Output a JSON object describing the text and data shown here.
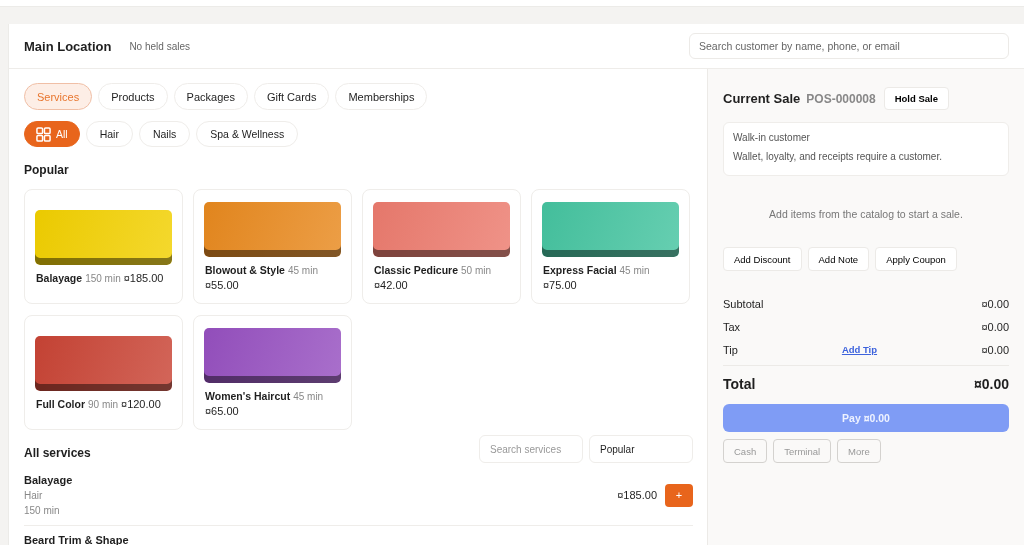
{
  "header": {
    "location": "Main Location",
    "held_sales": "No held sales",
    "customer_search": {
      "placeholder": "Search customer by name, phone, or email"
    }
  },
  "catalog": {
    "tabs": [
      {
        "label": "Services",
        "selected": true
      },
      {
        "label": "Products",
        "selected": false
      },
      {
        "label": "Packages",
        "selected": false
      },
      {
        "label": "Gift Cards",
        "selected": false
      },
      {
        "label": "Memberships",
        "selected": false
      }
    ],
    "filters": [
      {
        "label": "All",
        "selected": true,
        "kind": "grid"
      },
      {
        "label": "Hair",
        "selected": false,
        "kind": "plain"
      },
      {
        "label": "Nails",
        "selected": false,
        "kind": "plain"
      },
      {
        "label": "Spa & Wellness",
        "selected": false,
        "kind": "plain"
      }
    ],
    "popular_title": "Popular",
    "popular": [
      {
        "name": "Balayage",
        "duration": "150 min",
        "price": "¤185.00",
        "color": "#f2d000"
      },
      {
        "name": "Blowout & Style",
        "duration": "45 min",
        "price": "¤55.00",
        "color": "#e8891e"
      },
      {
        "name": "Classic Pedicure",
        "duration": "50 min",
        "price": "¤42.00",
        "color": "#ec7b6e"
      },
      {
        "name": "Express Facial",
        "duration": "45 min",
        "price": "¤75.00",
        "color": "#45c4a0"
      },
      {
        "name": "Full Color",
        "duration": "90 min",
        "price": "¤120.00",
        "color": "#c94435"
      },
      {
        "name": "Women's Haircut",
        "duration": "45 min",
        "price": "¤65.00",
        "color": "#9650c0"
      }
    ],
    "all_title": "All services",
    "service_search": {
      "placeholder": "Search services"
    },
    "sort": "Popular",
    "services": [
      {
        "name": "Balayage",
        "category": "Hair",
        "duration": "150 min",
        "price": "¤185.00",
        "add": "+"
      },
      {
        "name": "Beard Trim & Shape"
      }
    ]
  },
  "sale": {
    "title": "Current Sale",
    "number": "POS-000008",
    "hold": "Hold Sale",
    "customer": "Walk-in customer",
    "customer_note": "Wallet, loyalty, and receipts require a customer.",
    "empty": "Add items from the catalog to start a sale.",
    "actions": [
      "Add Discount",
      "Add Note",
      "Apply Coupon"
    ],
    "totals": [
      {
        "label": "Subtotal",
        "value": "¤0.00"
      },
      {
        "label": "Tax",
        "value": "¤0.00"
      },
      {
        "label": "Tip",
        "value": "¤0.00",
        "link": "Add Tip"
      }
    ],
    "total": {
      "label": "Total",
      "value": "¤0.00"
    },
    "pay": {
      "label": "Pay ¤0.00",
      "disabled": true
    },
    "methods": [
      {
        "label": "Cash",
        "disabled": true
      },
      {
        "label": "Terminal",
        "disabled": true
      },
      {
        "label": "More",
        "disabled": true
      }
    ]
  }
}
